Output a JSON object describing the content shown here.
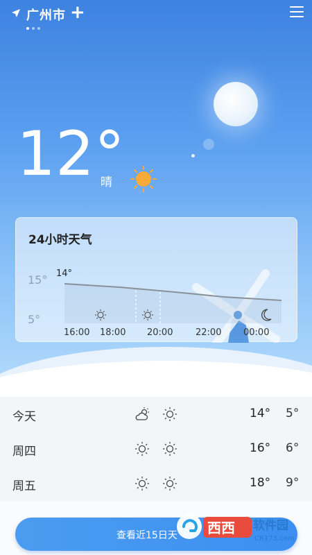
{
  "header": {
    "city": "广州市",
    "add_label": "+",
    "page_dots": 3
  },
  "current": {
    "temperature": "12°",
    "condition": "晴",
    "icon": "sun-icon"
  },
  "hourly_card": {
    "title": "24小时天气",
    "y_labels": [
      "15°",
      "5°"
    ],
    "peak_label": "14°",
    "times": [
      "16:00",
      "18:00",
      "20:00",
      "22:00",
      "00:00"
    ],
    "icons": [
      "sun-icon",
      "sun-icon",
      "moon-icon"
    ]
  },
  "daily": [
    {
      "day": "今天",
      "icon_day": "partly-cloudy-icon",
      "icon_night": "sun-icon",
      "high": "14°",
      "low": "5°"
    },
    {
      "day": "周四",
      "icon_day": "sun-icon",
      "icon_night": "sun-icon",
      "high": "16°",
      "low": "6°"
    },
    {
      "day": "周五",
      "icon_day": "sun-icon",
      "icon_night": "sun-icon",
      "high": "18°",
      "low": "9°"
    }
  ],
  "footer": {
    "button_label": "查看近15日天"
  },
  "watermark": {
    "text": "西西软件园",
    "url_text": "CR173.com"
  },
  "colors": {
    "sky_top": "#3d82e0",
    "sky_bottom": "#b6dcfb",
    "accent": "#3c8ff0",
    "sun": "#f7a93a"
  }
}
